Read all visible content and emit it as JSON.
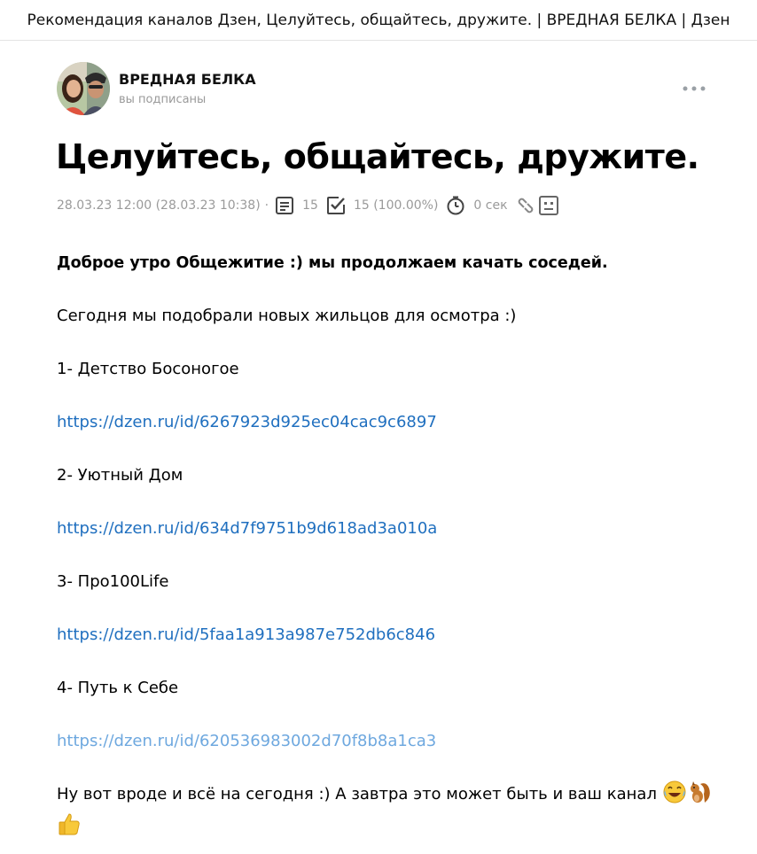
{
  "window": {
    "title": "Рекомендация каналов Дзен, Целуйтесь, общайтесь, дружите. | ВРЕДНАЯ БЕЛКА | Дзен"
  },
  "channel": {
    "name": "ВРЕДНАЯ БЕЛКА",
    "status": "вы подписаны"
  },
  "article": {
    "title": "Целуйтесь, общайтесь, дружите.",
    "meta": {
      "date": "28.03.23 12:00 (28.03.23 10:38)",
      "separator": "·",
      "views": "15",
      "reads": "15 (100.00%)",
      "read_time": "0 сек"
    },
    "paragraphs": {
      "intro": "Доброе утро Общежитие :) мы продолжаем качать соседей.",
      "lead": "Сегодня мы подобрали новых жильцов для осмотра :)",
      "item1": "1- Детство Босоногое",
      "link1": "https://dzen.ru/id/6267923d925ec04cac9c6897",
      "item2": "2- Уютный Дом",
      "link2": "https://dzen.ru/id/634d7f9751b9d618ad3a010a",
      "item3": "3- Про100Life",
      "link3": "https://dzen.ru/id/5faa1a913a987e752db6c846",
      "item4": "4- Путь к Себе",
      "link4": "https://dzen.ru/id/620536983002d70f8b8a1ca3",
      "outro": "Ну вот вроде и всё на сегодня :) А завтра это может быть и ваш канал"
    }
  },
  "icons": {
    "avatar": "channel-avatar-photo",
    "more": "more-dots-icon",
    "views": "document-icon",
    "reads": "checkbox-icon",
    "read_time": "clock-icon",
    "link": "link-icon",
    "sad": "sad-face-icon",
    "emoji1": "laughing-tears-emoji",
    "emoji2": "squirrel-emoji",
    "emoji3": "thumbs-up-emoji"
  },
  "colors": {
    "link": "#1f6fbf",
    "link_visited": "#6ea8df",
    "muted": "#9a9a9a",
    "title": "#000000"
  }
}
